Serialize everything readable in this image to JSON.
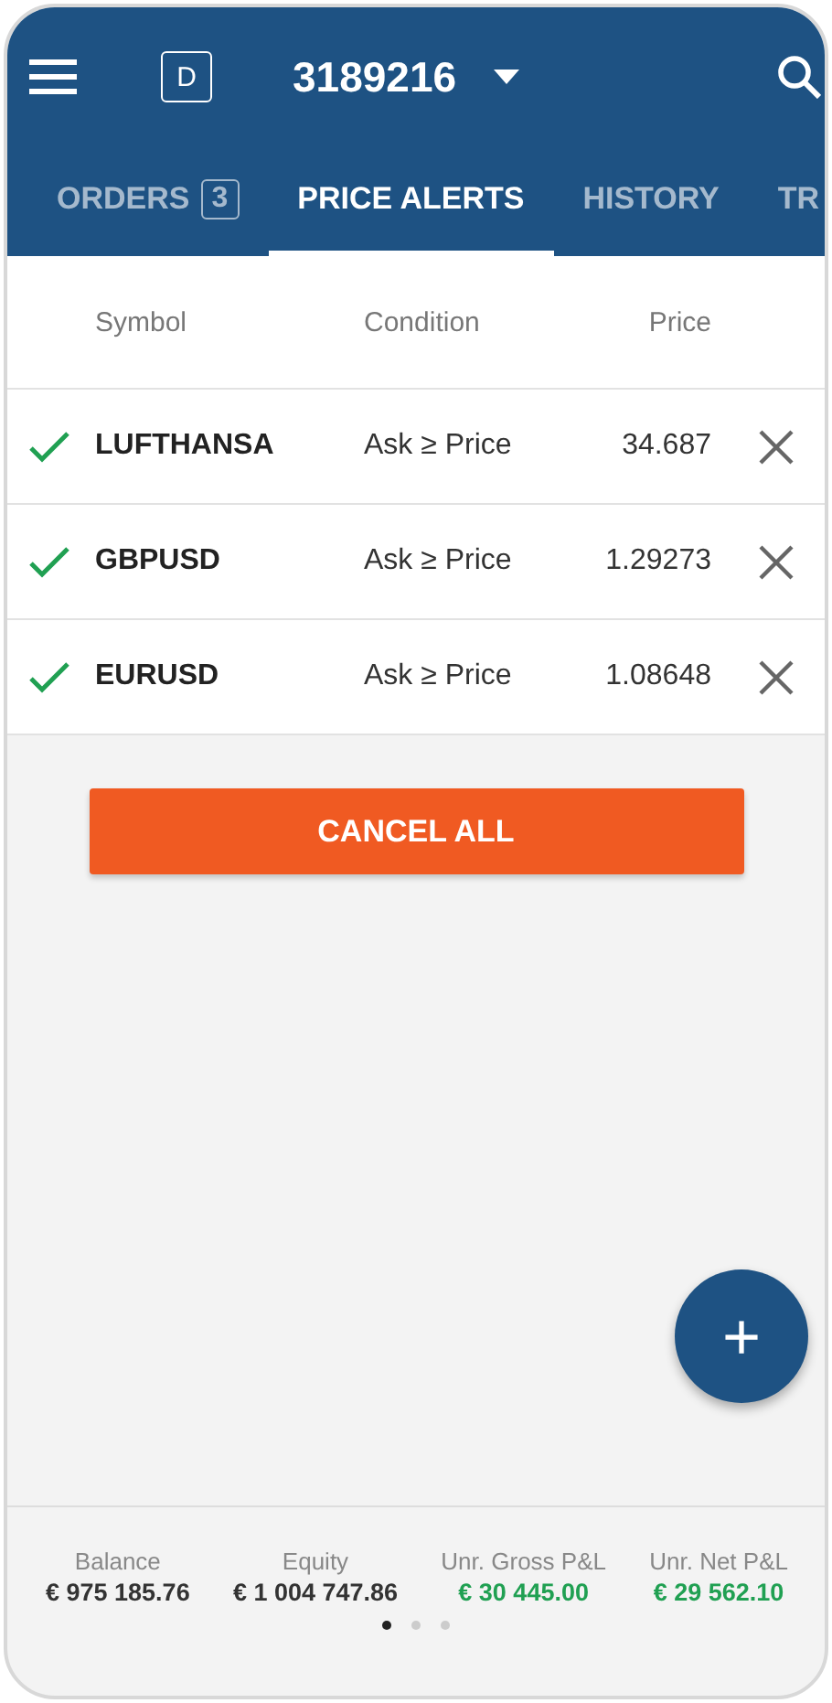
{
  "header": {
    "account_badge": "D",
    "account_number": "3189216"
  },
  "tabs": [
    {
      "label": "ORDERS",
      "count": "3",
      "selected": false
    },
    {
      "label": "PRICE ALERTS",
      "selected": true
    },
    {
      "label": "HISTORY",
      "selected": false
    },
    {
      "label": "TR",
      "selected": false
    }
  ],
  "table": {
    "columns": [
      "Symbol",
      "Condition",
      "Price"
    ],
    "rows": [
      {
        "active": true,
        "symbol": "LUFTHANSA",
        "condition": "Ask ≥ Price",
        "price": "34.687"
      },
      {
        "active": true,
        "symbol": "GBPUSD",
        "condition": "Ask ≥ Price",
        "price": "1.29273"
      },
      {
        "active": true,
        "symbol": "EURUSD",
        "condition": "Ask ≥ Price",
        "price": "1.08648"
      }
    ]
  },
  "cancel_button": "CANCEL ALL",
  "fab": "+",
  "summary": [
    {
      "label": "Balance",
      "value": "€ 975 185.76",
      "color": "#333333"
    },
    {
      "label": "Equity",
      "value": "€ 1 004 747.86",
      "color": "#333333"
    },
    {
      "label": "Unr. Gross P&L",
      "value": "€ 30 445.00",
      "color": "#20a052"
    },
    {
      "label": "Unr. Net P&L",
      "value": "€ 29 562.10",
      "color": "#20a052"
    }
  ],
  "pager": [
    {
      "selected": true
    },
    {
      "selected": false
    },
    {
      "selected": false
    }
  ]
}
